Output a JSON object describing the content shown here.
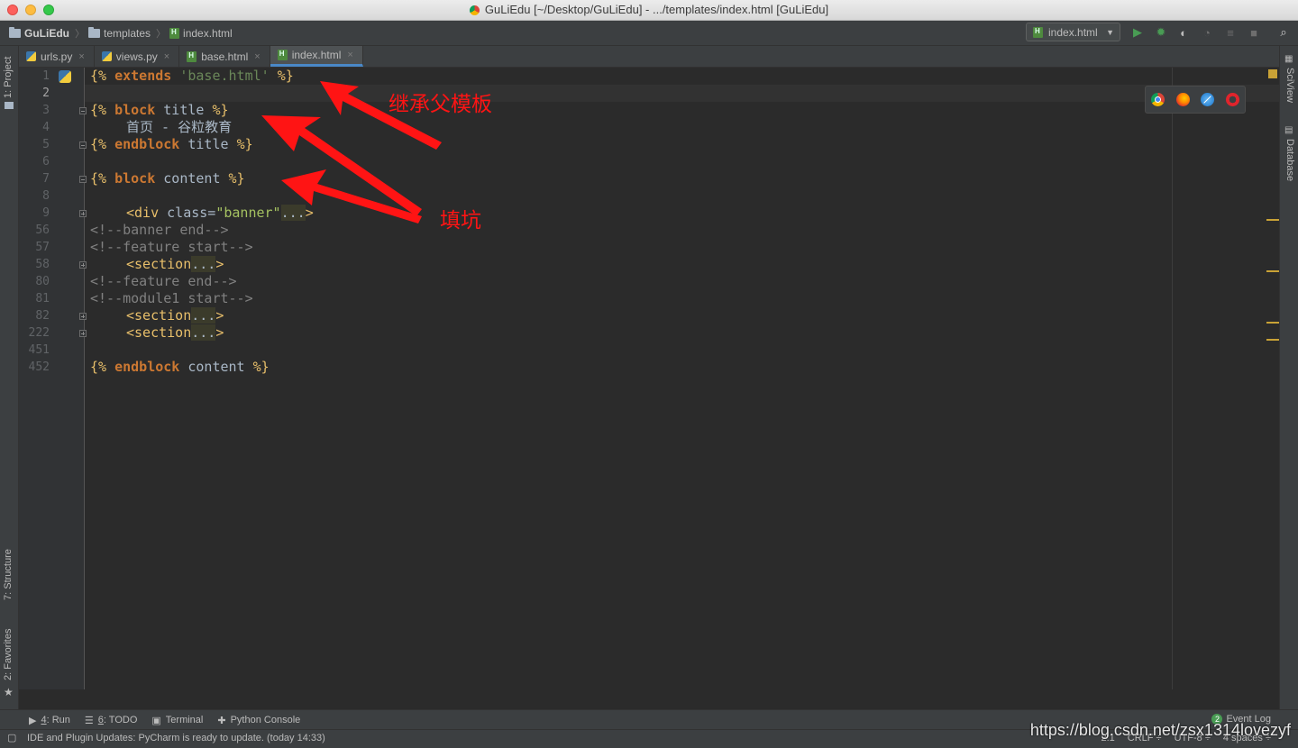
{
  "window": {
    "title": "GuLiEdu [~/Desktop/GuLiEdu] - .../templates/index.html [GuLiEdu]"
  },
  "breadcrumb": {
    "project": "GuLiEdu",
    "folder": "templates",
    "file": "index.html"
  },
  "run_config": {
    "label": "index.html"
  },
  "left_tools": {
    "project": "1: Project",
    "structure": "7: Structure",
    "favorites": "2: Favorites"
  },
  "right_tools": {
    "sciview": "SciView",
    "database": "Database"
  },
  "tabs": [
    {
      "label": "urls.py",
      "icon": "python-file-icon"
    },
    {
      "label": "views.py",
      "icon": "python-file-icon"
    },
    {
      "label": "base.html",
      "icon": "html-file-icon"
    },
    {
      "label": "index.html",
      "icon": "html-file-icon",
      "active": true
    }
  ],
  "line_numbers": [
    "1",
    "2",
    "3",
    "4",
    "5",
    "6",
    "7",
    "8",
    "9",
    "56",
    "57",
    "58",
    "80",
    "81",
    "82",
    "222",
    "451",
    "452"
  ],
  "code": {
    "l1_open": "{%",
    "l1_kw": "extends",
    "l1_str": "'base.html'",
    "l1_close": "%}",
    "l3_open": "{%",
    "l3_kw": "block",
    "l3_name": "title",
    "l3_close": "%}",
    "l4_text": "首页 - 谷粒教育",
    "l5_open": "{%",
    "l5_kw": "endblock",
    "l5_name": "title",
    "l5_close": "%}",
    "l7_open": "{%",
    "l7_kw": "block",
    "l7_name": "content",
    "l7_close": "%}",
    "l9_tag": "<div",
    "l9_attr": "class=",
    "l9_val": "\"banner\"",
    "l9_fold": "...",
    "l9_end": ">",
    "l56": "<!--banner end-->",
    "l57": "<!--feature start-->",
    "l58_tag": "<section",
    "l58_fold": "...",
    "l58_end": ">",
    "l80": "<!--feature end-->",
    "l81": "<!--module1 start-->",
    "l82_tag": "<section",
    "l82_fold": "...",
    "l82_end": ">",
    "l222_tag": "<section",
    "l222_fold": "...",
    "l222_end": ">",
    "l452_open": "{%",
    "l452_kw": "endblock",
    "l452_name": "content",
    "l452_close": "%}"
  },
  "annotations": {
    "inherit": "继承父模板",
    "fill": "填坑"
  },
  "bottom_tools": [
    {
      "key": "4",
      "label": ": Run"
    },
    {
      "key": "6",
      "label": ": TODO"
    },
    {
      "key": "",
      "label": "Terminal"
    },
    {
      "key": "",
      "label": "Python Console"
    }
  ],
  "event_log": {
    "count": "2",
    "label": "Event Log"
  },
  "status": {
    "message": "IDE and Plugin Updates: PyCharm is ready to update. (today 14:33)",
    "position": "2:1",
    "line_sep": "CRLF ÷",
    "encoding": "UTF-8 ÷",
    "indent": "4 spaces ÷"
  },
  "watermark": "https://blog.csdn.net/zsx1314lovezyf",
  "colors": {
    "annotation": "#ff1414",
    "accent": "#4a88c7",
    "keyword": "#cc7832",
    "string": "#6a8759",
    "comment": "#808080"
  }
}
